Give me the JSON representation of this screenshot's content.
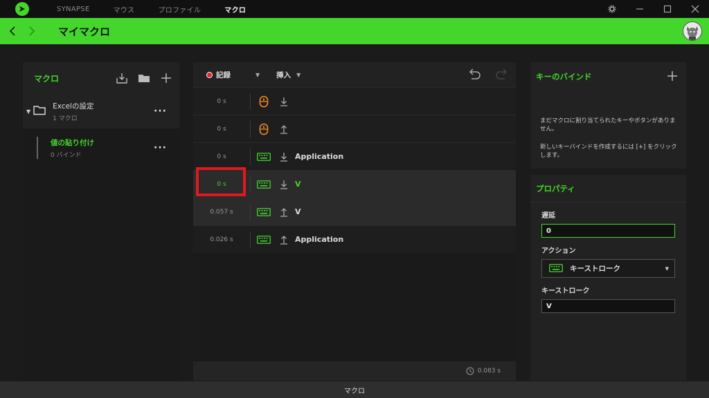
{
  "nav": {
    "tabs": [
      {
        "label": "SYNAPSE"
      },
      {
        "label": "マウス"
      },
      {
        "label": "プロファイル"
      },
      {
        "label": "マクロ"
      }
    ]
  },
  "header": {
    "title": "マイマクロ"
  },
  "macros_panel": {
    "title": "マクロ",
    "folder": {
      "name": "Excelの設定",
      "count": "1 マクロ"
    },
    "macro": {
      "name": "値の貼り付け",
      "binds": "0 バインド"
    }
  },
  "toolbar": {
    "record_label": "記録",
    "insert_label": "挿入"
  },
  "events": [
    {
      "delay": "0 s",
      "device": "mouse",
      "dir": "down",
      "key": ""
    },
    {
      "delay": "0 s",
      "device": "mouse",
      "dir": "up",
      "key": ""
    },
    {
      "delay": "0 s",
      "device": "keyboard",
      "dir": "down",
      "key": "Application"
    },
    {
      "delay": "0 s",
      "device": "keyboard",
      "dir": "down",
      "key": "V"
    },
    {
      "delay": "0.057 s",
      "device": "keyboard",
      "dir": "up",
      "key": "V"
    },
    {
      "delay": "0.026 s",
      "device": "keyboard",
      "dir": "up",
      "key": "Application"
    }
  ],
  "footer": {
    "total": "0.083 s"
  },
  "keybind_panel": {
    "title": "キーのバインド",
    "line1": "まだマクロに割り当てられたキーやボタンがありません。",
    "line2": "新しいキーバインドを作成するには [+] をクリックします。"
  },
  "properties": {
    "title": "プロパティ",
    "delay_label": "遅延",
    "delay_value": "0",
    "action_label": "アクション",
    "action_value": "キーストローク",
    "keystroke_label": "キーストローク",
    "keystroke_value": "V"
  },
  "status": {
    "text": "マクロ"
  },
  "colors": {
    "accent": "#44d62c",
    "highlight": "#e0191e",
    "mouse_icon": "#f08a24"
  }
}
